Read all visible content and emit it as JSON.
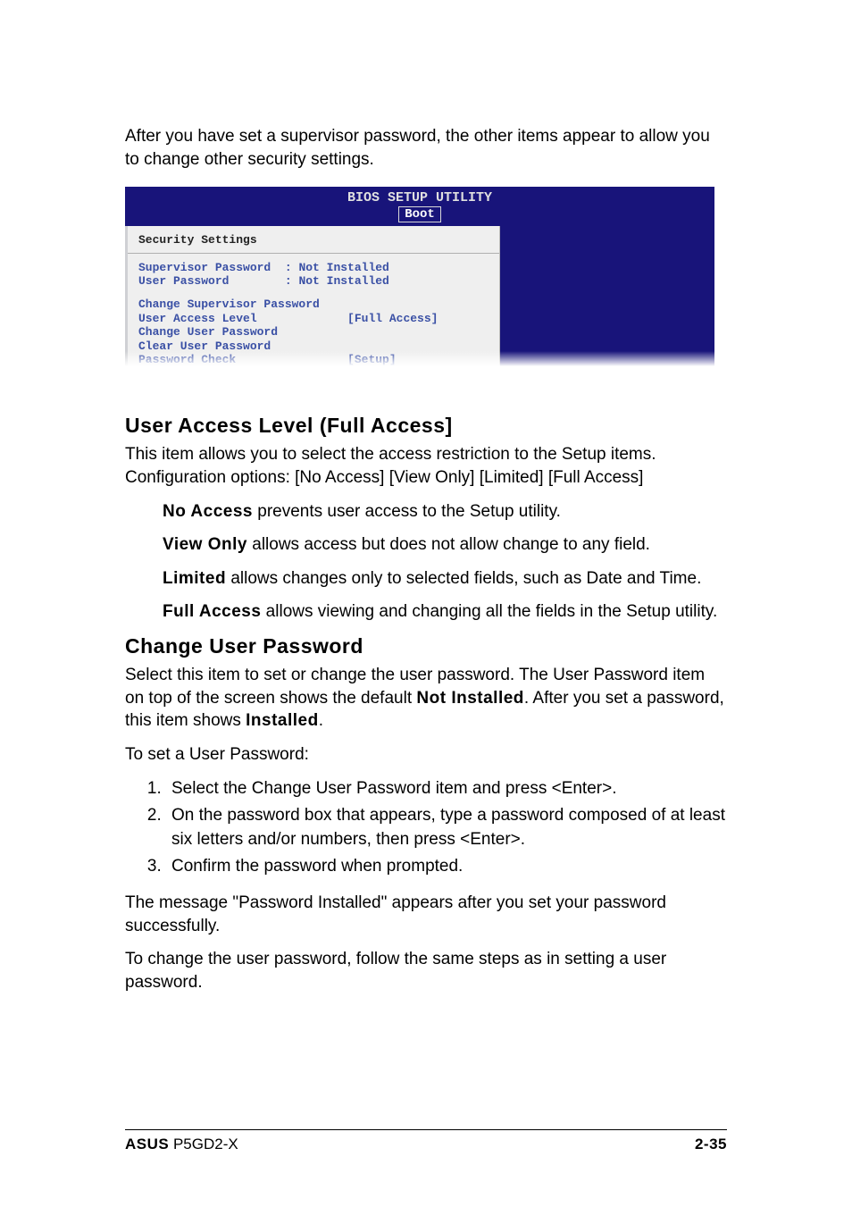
{
  "intro": "After you have set a supervisor password, the other items appear to allow you to change other security settings.",
  "bios": {
    "title": "BIOS SETUP UTILITY",
    "tab_label": "Boot",
    "section_label": "Security Settings",
    "status_rows": [
      {
        "label": "Supervisor Password",
        "value": ": Not Installed"
      },
      {
        "label": "User Password",
        "value": ": Not Installed"
      }
    ],
    "config_rows": [
      {
        "label": "Change Supervisor Password",
        "value": ""
      },
      {
        "label": "User Access Level",
        "value": "[Full Access]"
      },
      {
        "label": "Change User Password",
        "value": ""
      },
      {
        "label": "Clear User Password",
        "value": ""
      },
      {
        "label": "Password Check",
        "value": "[Setup]"
      }
    ]
  },
  "sections": {
    "user_access": {
      "heading": "User Access Level (Full Access]",
      "intro": "This item allows you to select the access restriction to the Setup items. Configuration options: [No Access] [View Only] [Limited] [Full Access]",
      "options": [
        {
          "name": "No Access",
          "desc": " prevents user access to the Setup utility."
        },
        {
          "name": "View Only",
          "desc": " allows access but does not allow change to any field."
        },
        {
          "name": "Limited",
          "desc": " allows changes only to selected fields, such as Date and Time."
        },
        {
          "name": "Full Access",
          "desc": " allows viewing and changing all the fields in the Setup utility."
        }
      ]
    },
    "change_user_pw": {
      "heading": "Change User Password",
      "intro_pre": "Select this item to set or change the user password. The User Password item on top of the screen shows the default ",
      "intro_bold1": "Not Installed",
      "intro_mid": ". After you set a password, this item shows ",
      "intro_bold2": "Installed",
      "intro_post": ".",
      "to_set": "To set a User Password:",
      "steps": [
        "Select the Change User Password item and press <Enter>.",
        "On the password box that appears, type a password composed of at least six letters and/or numbers, then press <Enter>.",
        "Confirm the password when prompted."
      ],
      "after": "The message \"Password Installed\" appears after you set your password successfully.",
      "change": "To change the user password, follow the same steps as in setting a user password."
    }
  },
  "footer": {
    "brand": "ASUS",
    "model": " P5GD2-X",
    "page": "2-35"
  }
}
